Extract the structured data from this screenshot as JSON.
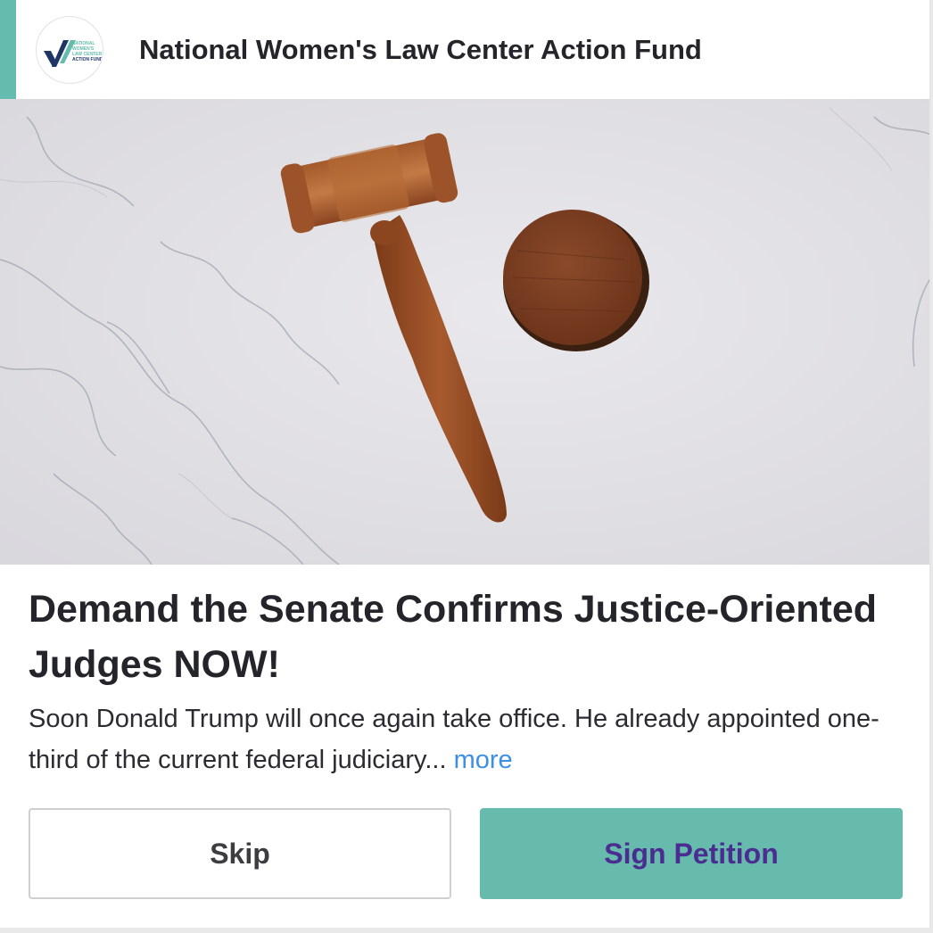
{
  "header": {
    "org_name": "National Women's Law Center Action Fund",
    "logo": {
      "icon": "nwlc-action-fund-logo",
      "lines": [
        "NATIONAL",
        "WOMEN'S",
        "LAW CENTER",
        "ACTION FUND"
      ],
      "colors": {
        "teal": "#65bcae",
        "navy": "#1f3566"
      }
    }
  },
  "hero": {
    "image": "wooden-gavel-on-marble-photo"
  },
  "petition": {
    "title": "Demand the Senate Confirms Justice-Oriented Judges NOW!",
    "description": "Soon Donald Trump will once again take office. He already appointed one-third of the current federal judiciary...",
    "more_label": "more"
  },
  "actions": {
    "skip_label": "Skip",
    "sign_label": "Sign Petition"
  },
  "colors": {
    "accent": "#65bcae",
    "sign_button_bg": "#66bbad",
    "sign_button_text": "#4b2d91",
    "link": "#3d8fe6"
  }
}
